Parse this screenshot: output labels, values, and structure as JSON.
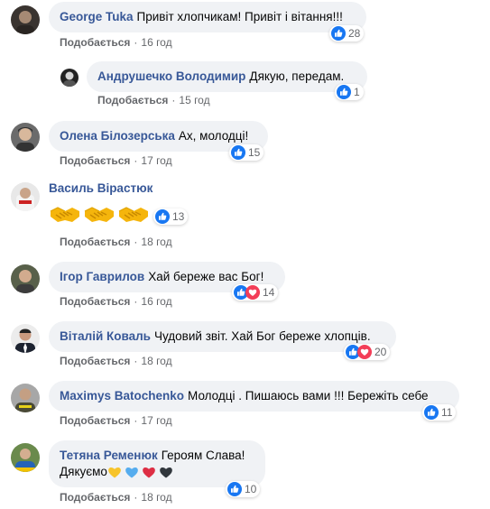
{
  "common": {
    "like_label": "Подобається",
    "separator": "·"
  },
  "comments": [
    {
      "author": "George Tuka",
      "text": "Привіт хлопчикам! Привіт і вітання!!!",
      "time": "16 год",
      "reactions": "28"
    },
    {
      "author": "Андрушечко Володимир",
      "text": "Дякую, передам.",
      "time": "15 год",
      "reactions": "1"
    },
    {
      "author": "Олена Білозерська",
      "text": "Ах, молодці!",
      "time": "17 год",
      "reactions": "15"
    },
    {
      "author": "Василь Вірастюк",
      "text": "",
      "time": "18 год",
      "reactions": "13"
    },
    {
      "author": "Ігор Гаврилов",
      "text": "Хай береже вас Бог!",
      "time": "16 год",
      "reactions": "14"
    },
    {
      "author": "Віталій Коваль",
      "text": "Чудовий звіт. Хай Бог береже хлопців.",
      "time": "18 год",
      "reactions": "20"
    },
    {
      "author": "Maximys Batochenko",
      "text": "Молодці . Пишаюсь вами !!! Бережіть себе",
      "time": "17 год",
      "reactions": "11"
    },
    {
      "author": "Тетяна Ременюк",
      "text": "Героям Слава!",
      "text2": "Дякуємо",
      "time": "18 год",
      "reactions": "10"
    }
  ],
  "icons": {
    "like": "like-icon",
    "love": "love-icon",
    "handshake": "handshake-emoji",
    "hearts": [
      "yellow-heart-emoji",
      "blue-heart-emoji",
      "red-heart-emoji",
      "black-heart-emoji"
    ]
  },
  "colors": {
    "like": "#1877f2",
    "love": "#f33e58",
    "author": "#385898",
    "bubble": "#f0f2f5"
  }
}
